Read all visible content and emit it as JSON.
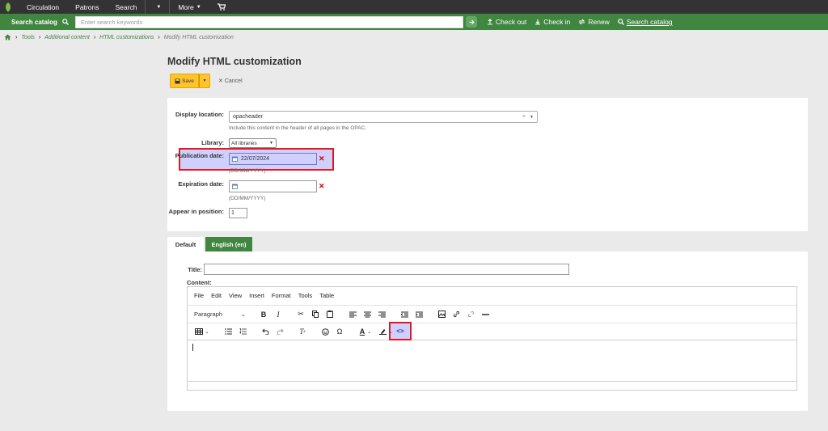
{
  "nav": {
    "items": [
      "Circulation",
      "Patrons",
      "Search",
      "More"
    ]
  },
  "searchbar": {
    "label": "Search catalog",
    "placeholder": "Enter search keywords",
    "links": [
      "Check out",
      "Check in",
      "Renew",
      "Search catalog"
    ]
  },
  "breadcrumb": [
    "Tools",
    "Additional content",
    "HTML customizations",
    "Modify HTML customization"
  ],
  "page": {
    "title": "Modify HTML customization",
    "save_label": "Save",
    "cancel_label": "Cancel"
  },
  "form": {
    "display_location_label": "Display location:",
    "display_location_value": "opacheader",
    "display_location_hint": "Include this content in the header of all pages in the OPAC.",
    "library_label": "Library:",
    "library_value": "All libraries",
    "publication_label": "Publication date:",
    "publication_value": "22/07/2024",
    "publication_hint": "(DD/MM/YYYY)",
    "expiration_label": "Expiration date:",
    "expiration_value": "",
    "expiration_hint": "(DD/MM/YYYY)",
    "position_label": "Appear in position:",
    "position_value": "1"
  },
  "tabs": [
    "Default",
    "English (en)"
  ],
  "content": {
    "title_label": "Title:",
    "content_label": "Content:",
    "title_value": ""
  },
  "editor": {
    "menus": [
      "File",
      "Edit",
      "View",
      "Insert",
      "Format",
      "Tools",
      "Table"
    ],
    "paragraph_label": "Paragraph"
  },
  "colors": {
    "brand_green": "#408540",
    "save_yellow": "#ffc32b",
    "highlight_red": "#e3191f"
  }
}
